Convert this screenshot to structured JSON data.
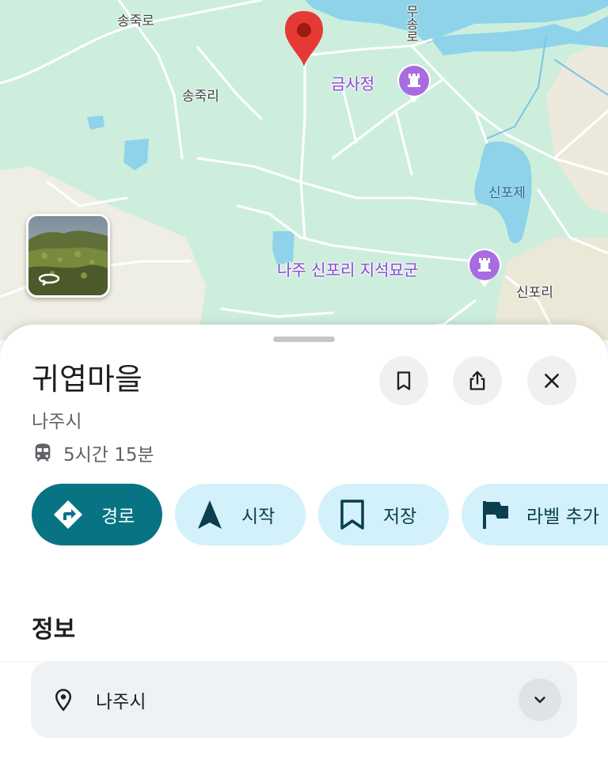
{
  "map": {
    "road_labels": [
      "송죽로",
      "무송로"
    ],
    "village_labels": [
      "송죽리",
      "신포리"
    ],
    "water_label": "신포제",
    "pois": [
      {
        "name": "금사정",
        "icon": "monument-icon"
      },
      {
        "name": "나주 신포리 지석묘군",
        "icon": "monument-icon"
      }
    ],
    "selected_pin_icon": "map-pin-icon",
    "streetview_icon": "rotate-360-icon",
    "colors": {
      "land": "#cdeedd",
      "water": "#8ed3ea",
      "poi": "#a86ce0",
      "pin": "#e53935"
    }
  },
  "place": {
    "title": "귀엽마을",
    "subtitle": "나주시",
    "transit_icon": "train-icon",
    "transit_time": "5시간 15분"
  },
  "header_buttons": [
    {
      "name": "save-button",
      "icon": "bookmark-icon"
    },
    {
      "name": "share-button",
      "icon": "share-icon"
    },
    {
      "name": "close-button",
      "icon": "close-icon"
    }
  ],
  "actions": {
    "directions": "경로",
    "start": "시작",
    "save": "저장",
    "add_label": "라벨 추가"
  },
  "info": {
    "section_title": "정보",
    "address": "나주시",
    "address_icon": "location-pin-icon",
    "expand_icon": "chevron-down-icon"
  },
  "colors": {
    "primary_button": "#087483",
    "secondary_button": "#d3f1fa"
  }
}
